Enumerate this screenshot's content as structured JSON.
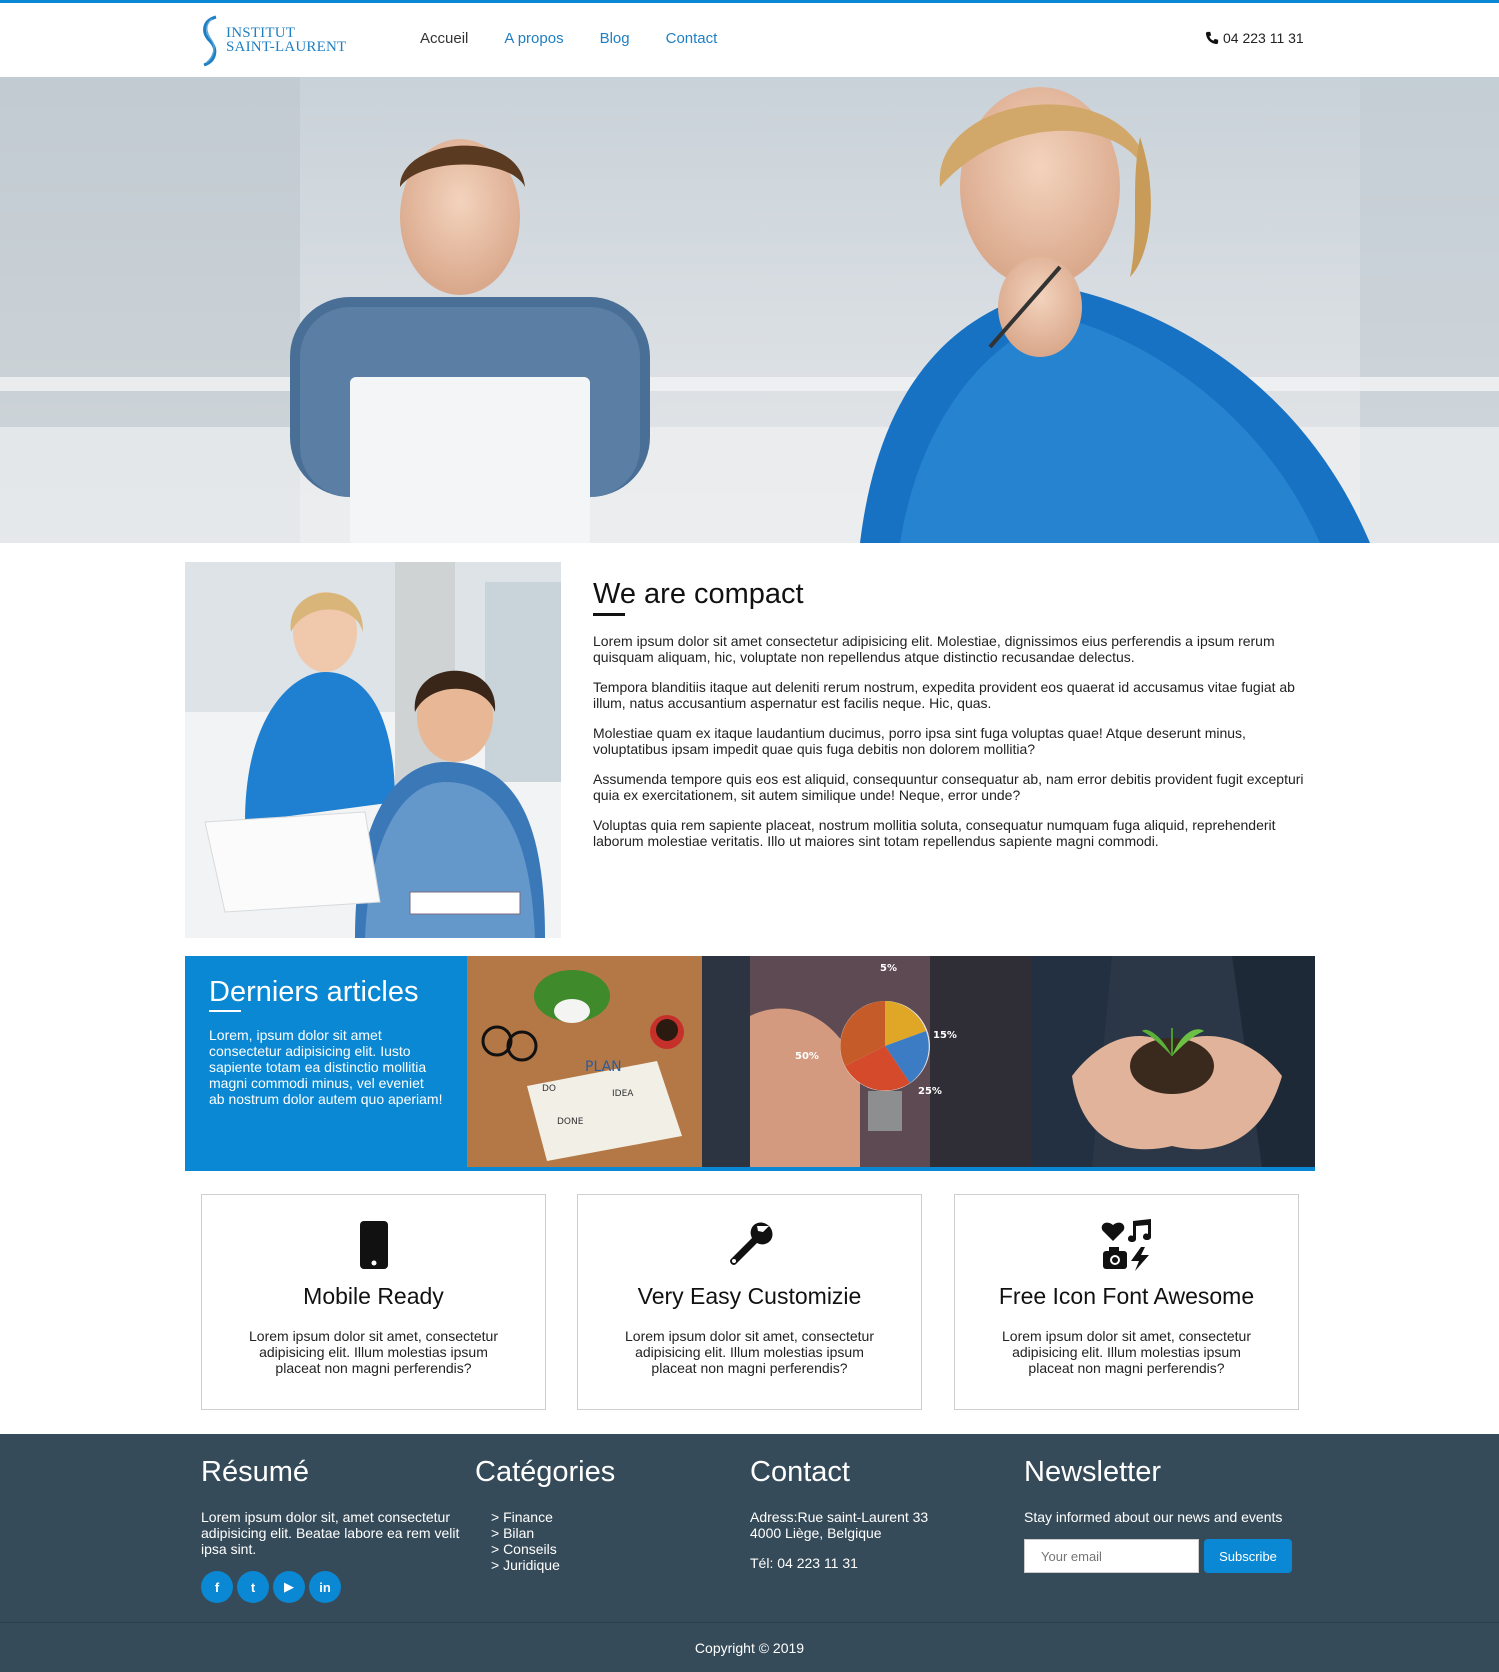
{
  "brand": {
    "line1": "INSTITUT",
    "line2": "SAINT-LAURENT"
  },
  "nav": {
    "items": [
      "Accueil",
      "A propos",
      "Blog",
      "Contact"
    ],
    "active": "Accueil"
  },
  "header": {
    "phone": "04 223 11 31",
    "phone_icon": "phone-icon"
  },
  "about": {
    "title": "We are compact",
    "paragraphs": [
      "Lorem ipsum dolor sit amet consectetur adipisicing elit. Molestiae, dignissimos eius perferendis a ipsum rerum quisquam aliquam, hic, voluptate non repellendus atque distinctio recusandae delectus.",
      "Tempora blanditiis itaque aut deleniti rerum nostrum, expedita provident eos quaerat id accusamus vitae fugiat ab illum, natus accusantium aspernatur est facilis neque. Hic, quas.",
      "Molestiae quam ex itaque laudantium ducimus, porro ipsa sint fuga voluptas quae! Atque deserunt minus, voluptatibus ipsam impedit quae quis fuga debitis non dolorem mollitia?",
      "Assumenda tempore quis eos est aliquid, consequuntur consequatur ab, nam error debitis provident fugit excepturi quia ex exercitationem, sit autem similique unde! Neque, error unde?",
      "Voluptas quia rem sapiente placeat, nostrum mollitia soluta, consequatur numquam fuga aliquid, reprehenderit laborum molestiae veritatis. Illo ut maiores sint totam repellendus sapiente magni commodi."
    ]
  },
  "articles": {
    "title": "Derniers articles",
    "text": "Lorem, ipsum dolor sit amet consectetur adipisicing elit. Iusto sapiente totam ea distinctio mollitia magni commodi minus, vel eveniet ab nostrum dolor autem quo aperiam!",
    "bulb_labels": [
      "5%",
      "15%",
      "50%",
      "25%"
    ],
    "plan_labels": [
      "PLAN",
      "DO",
      "IDEA",
      "DONE"
    ]
  },
  "features": [
    {
      "icon": "mobile-icon",
      "title": "Mobile Ready",
      "text": "Lorem ipsum dolor sit amet, consectetur adipisicing elit. Illum molestias ipsum placeat non magni perferendis?"
    },
    {
      "icon": "wrench-icon",
      "title": "Very Easy Customizie",
      "text": "Lorem ipsum dolor sit amet, consectetur adipisicing elit. Illum molestias ipsum placeat non magni perferendis?"
    },
    {
      "icon": "icons-icon",
      "title": "Free Icon Font Awesome",
      "text": "Lorem ipsum dolor sit amet, consectetur adipisicing elit. Illum molestias ipsum placeat non magni perferendis?"
    }
  ],
  "footer": {
    "resume": {
      "title": "Résumé",
      "text": "Lorem ipsum dolor sit, amet consectetur adipisicing elit. Beatae labore ea rem velit ipsa sint."
    },
    "socials": [
      {
        "icon": "facebook-icon",
        "glyph": "f"
      },
      {
        "icon": "twitter-icon",
        "glyph": "t"
      },
      {
        "icon": "youtube-icon",
        "glyph": "▶"
      },
      {
        "icon": "linkedin-icon",
        "glyph": "in"
      }
    ],
    "categories": {
      "title": "Catégories",
      "items": [
        "> Finance",
        "> Bilan",
        "> Conseils",
        "> Juridique"
      ]
    },
    "contact": {
      "title": "Contact",
      "address1": "Adress:Rue saint-Laurent 33",
      "address2": "4000 Liège, Belgique",
      "phone": "Tél: 04 223 11 31"
    },
    "newsletter": {
      "title": "Newsletter",
      "text": "Stay informed about our news and events",
      "placeholder": "Your email",
      "button": "Subscribe"
    },
    "copyright": "Copyright © 2019"
  },
  "colors": {
    "accent": "#0a88d3",
    "footer": "#364b59",
    "link": "#1f7fc2"
  }
}
